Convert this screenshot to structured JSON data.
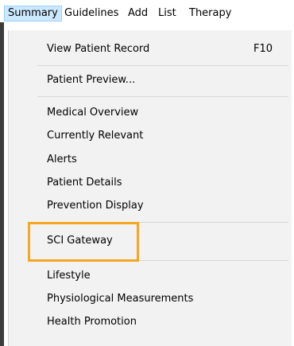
{
  "menubar": {
    "items": [
      {
        "label": "Summary"
      },
      {
        "label": "Guidelines"
      },
      {
        "label": "Add"
      },
      {
        "label": "List"
      },
      {
        "label": "Therapy"
      }
    ]
  },
  "dropdown": {
    "items": [
      {
        "label": "View Patient Record",
        "shortcut": "F10"
      },
      {
        "label": "Patient Preview..."
      },
      {
        "label": "Medical Overview"
      },
      {
        "label": "Currently Relevant"
      },
      {
        "label": "Alerts"
      },
      {
        "label": "Patient Details"
      },
      {
        "label": "Prevention Display"
      },
      {
        "label": "SCI Gateway"
      },
      {
        "label": "Lifestyle"
      },
      {
        "label": "Physiological Measurements"
      },
      {
        "label": "Health Promotion"
      }
    ]
  },
  "highlight": {
    "color": "#f5a623"
  }
}
